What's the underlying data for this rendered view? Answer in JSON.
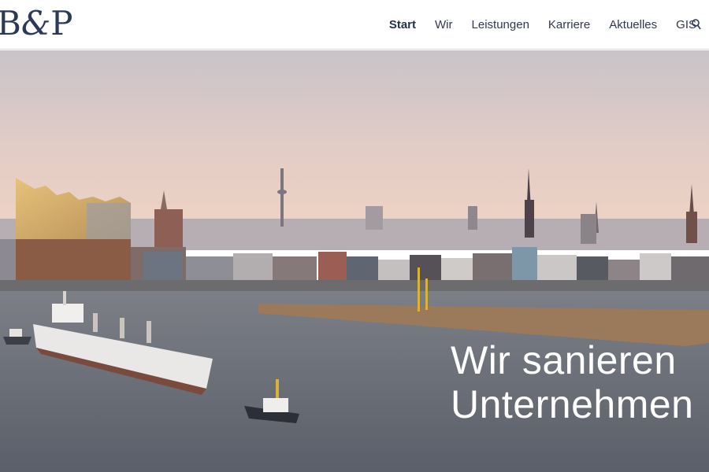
{
  "logo": {
    "text_left": "B",
    "text_amp": "&",
    "text_right": "P"
  },
  "nav": {
    "items": [
      {
        "label": "Start",
        "active": true
      },
      {
        "label": "Wir",
        "active": false
      },
      {
        "label": "Leistungen",
        "active": false
      },
      {
        "label": "Karriere",
        "active": false
      },
      {
        "label": "Aktuelles",
        "active": false
      },
      {
        "label": "GIS",
        "active": false
      }
    ],
    "search_icon": "search-icon"
  },
  "hero": {
    "headline_line1": "Wir sanieren",
    "headline_line2": "Unternehmen",
    "image_subject": "hamburg-harbor-skyline",
    "colors": {
      "sky_top": "#c8c2c8",
      "sky_bottom": "#eacfc2",
      "water": "#6a6f78",
      "brand": "#2c3a57"
    }
  }
}
